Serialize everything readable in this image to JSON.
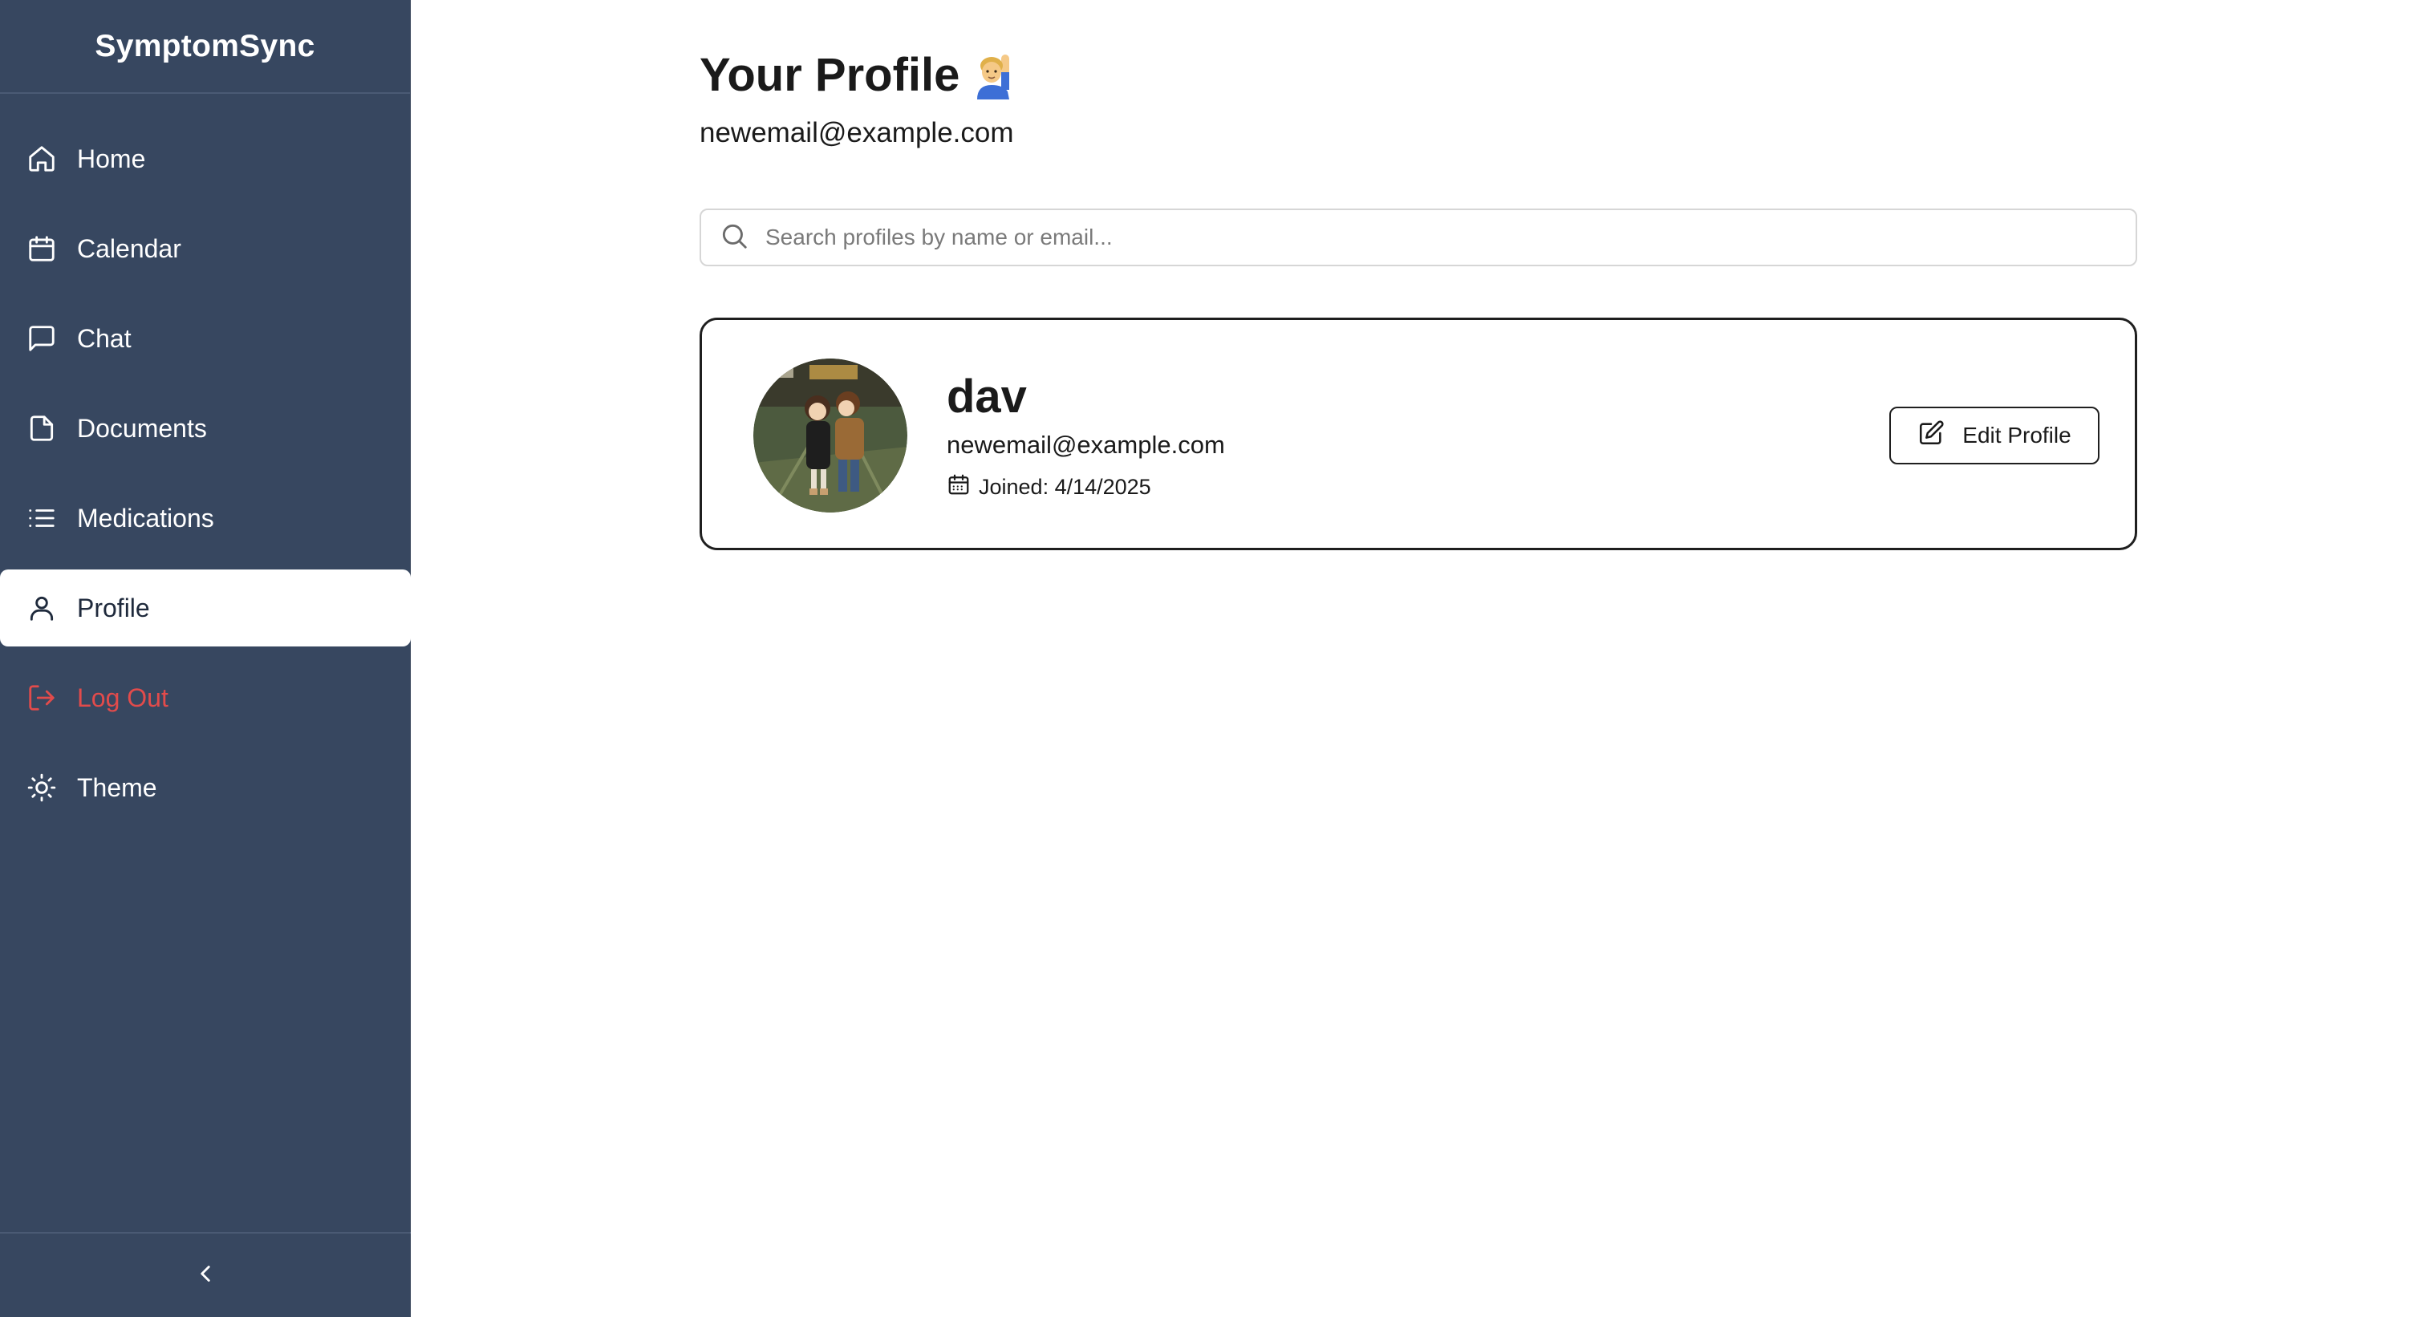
{
  "app": {
    "brand": "SymptomSync"
  },
  "sidebar": {
    "items": [
      {
        "label": "Home",
        "icon": "home-icon"
      },
      {
        "label": "Calendar",
        "icon": "calendar-icon"
      },
      {
        "label": "Chat",
        "icon": "chat-icon"
      },
      {
        "label": "Documents",
        "icon": "document-icon"
      },
      {
        "label": "Medications",
        "icon": "list-icon"
      },
      {
        "label": "Profile",
        "icon": "user-icon",
        "active": true
      },
      {
        "label": "Log Out",
        "icon": "logout-icon",
        "color": "#e24b4b"
      },
      {
        "label": "Theme",
        "icon": "sun-icon"
      }
    ],
    "collapse_icon": "chevron-left-icon"
  },
  "page": {
    "title": "Your Profile",
    "title_emoji": "🙋‍♂️",
    "email": "newemail@example.com"
  },
  "search": {
    "placeholder": "Search profiles by name or email..."
  },
  "profile_card": {
    "name": "dav",
    "email": "newemail@example.com",
    "joined": "Joined: 4/14/2025",
    "edit_label": "Edit Profile"
  },
  "colors": {
    "sidebar_bg": "#374760",
    "logout": "#e24b4b",
    "active_bg": "#ffffff"
  }
}
